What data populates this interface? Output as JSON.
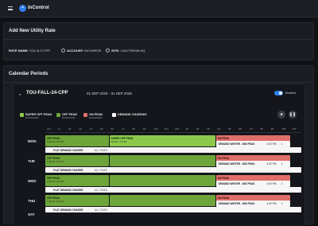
{
  "app": {
    "title": "InControl",
    "logo_letter": "•"
  },
  "utility_rate": {
    "title": "Add New Utility Rate",
    "rate_name_label": "RATE NAME:",
    "rate_name_value": "TOU-B-O CPP",
    "account_label": "ACCOUNT:",
    "account_value": "INCHARGE",
    "site_label": "SITE:",
    "site_value": "CALIFORNIA HQ"
  },
  "calendar": {
    "title": "Calendar Periods",
    "period_name": "TOU-FALL-24-CPP",
    "date_range": "01 SEP 2025 - 31 SEP 2025",
    "enabled_label": "Enabled",
    "enabled": true,
    "legend": [
      {
        "label": "SUPER OFF PEAK",
        "sub": "$0.01820/kWh",
        "color": "#8cc94b"
      },
      {
        "label": "OFF PEAK",
        "sub": "$0.01820/kWh",
        "color": "#6ea53a"
      },
      {
        "label": "ON PEAK",
        "sub": "$0.01820/kWh",
        "color": "#e06f6a"
      },
      {
        "label": "DEMAND CHARGES",
        "sub": "",
        "color": "#f6f6f7"
      }
    ],
    "hours": [
      "12A",
      "1A",
      "2A",
      "3A",
      "4A",
      "5A",
      "6A",
      "7A",
      "8A",
      "9A",
      "10A",
      "11A",
      "12P",
      "1P",
      "2P",
      "3P",
      "4P",
      "5P",
      "6P",
      "7P",
      "8P",
      "9P",
      "10P",
      "11P"
    ],
    "days": [
      {
        "name": "MON",
        "off_peak": "OFF PEAK",
        "off_peak_sub": "12:00 AM - 8:00 AM",
        "super_off_peak": "SUPER OFF PEAK",
        "super_sub": "8:00 AM - 4:00 PM",
        "on_peak": "ON PEAK",
        "on_peak_sub": "4:00 PM - 11:00 PM",
        "demand_label": "DEMAND WINTER - MID PEAK",
        "demand_time": "4:00 PM",
        "demand_num": "1",
        "flat_label": "FLAT DEMAND CHARGE",
        "flat_note": "ALL TIMES"
      },
      {
        "name": "TUE",
        "off_peak": "OFF PEAK",
        "off_peak_sub": "12:00 AM - 8:00 AM",
        "super_off_peak": "",
        "super_sub": "",
        "on_peak": "ON PEAK",
        "on_peak_sub": "4:00 PM - 11:00 PM",
        "demand_label": "DEMAND WINTER - MID PEAK",
        "demand_time": "4:00 PM",
        "demand_num": "1",
        "flat_label": "FLAT DEMAND CHARGE",
        "flat_note": "ALL TIMES"
      },
      {
        "name": "WED",
        "off_peak": "OFF PEAK",
        "off_peak_sub": "12:00 AM - 8:00 AM",
        "super_off_peak": "",
        "super_sub": "",
        "on_peak": "ON PEAK",
        "on_peak_sub": "4:00 PM - 11:00 PM",
        "demand_label": "DEMAND WINTER - MID PEAK",
        "demand_time": "4:00 PM",
        "demand_num": "1",
        "flat_label": "FLAT DEMAND CHARGE",
        "flat_note": "ALL TIMES"
      },
      {
        "name": "THU",
        "off_peak": "OFF PEAK",
        "off_peak_sub": "12:00 AM - 8:00 AM",
        "super_off_peak": "",
        "super_sub": "",
        "on_peak": "ON PEAK",
        "on_peak_sub": "4:00 PM - 11:00 PM",
        "demand_label": "DEMAND WINTER - MID PEAK",
        "demand_time": "4:00 PM",
        "demand_num": "1",
        "flat_label": "FLAT DEMAND CHARGE",
        "flat_note": "ALL TIMES"
      }
    ],
    "partial_day": "SAT"
  }
}
